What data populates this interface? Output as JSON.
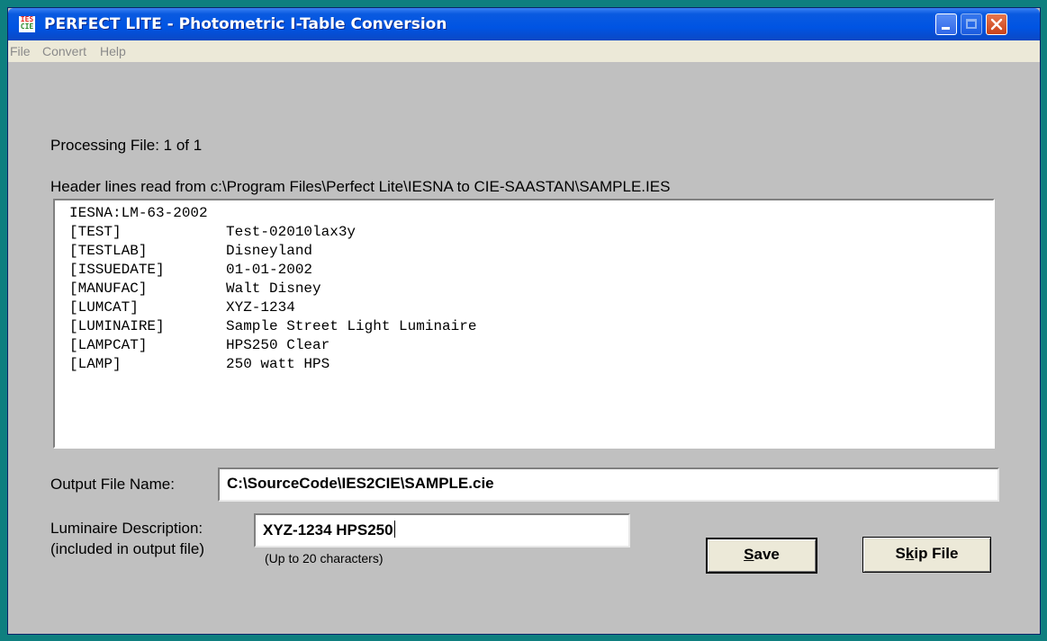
{
  "window": {
    "title": "PERFECT LITE - Photometric I-Table Conversion",
    "icon_top": "IES",
    "icon_bottom": "CIE"
  },
  "menu": {
    "file": "File",
    "convert": "Convert",
    "help": "Help"
  },
  "processing": "Processing File: 1 of 1",
  "header_caption": "Header lines read from c:\\Program Files\\Perfect Lite\\IESNA to CIE-SAASTAN\\SAMPLE.IES",
  "header_first_line": "IESNA:LM-63-2002",
  "header_lines": [
    {
      "key": "[TEST]",
      "value": "Test-02010lax3y"
    },
    {
      "key": "[TESTLAB]",
      "value": "Disneyland"
    },
    {
      "key": "[ISSUEDATE]",
      "value": "01-01-2002"
    },
    {
      "key": "[MANUFAC]",
      "value": "Walt Disney"
    },
    {
      "key": "[LUMCAT]",
      "value": "XYZ-1234"
    },
    {
      "key": "[LUMINAIRE]",
      "value": "Sample Street Light Luminaire"
    },
    {
      "key": "[LAMPCAT]",
      "value": "HPS250 Clear"
    },
    {
      "key": "[LAMP]",
      "value": "250 watt HPS"
    }
  ],
  "output": {
    "label": "Output File Name:",
    "value": "C:\\SourceCode\\IES2CIE\\SAMPLE.cie"
  },
  "luminaire": {
    "label": "Luminaire Description:",
    "sublabel": "(included in output file)",
    "value": "XYZ-1234 HPS250",
    "hint": "(Up to 20 characters)"
  },
  "buttons": {
    "save_mnemonic": "S",
    "save_rest": "ave",
    "skip_pre": "S",
    "skip_mnemonic": "k",
    "skip_rest": "ip File"
  },
  "colors": {
    "desktop": "#0e7f7f",
    "title_bar": "#0054e3",
    "window_bg": "#c0c0c0",
    "menu_bg": "#ece9d8"
  }
}
